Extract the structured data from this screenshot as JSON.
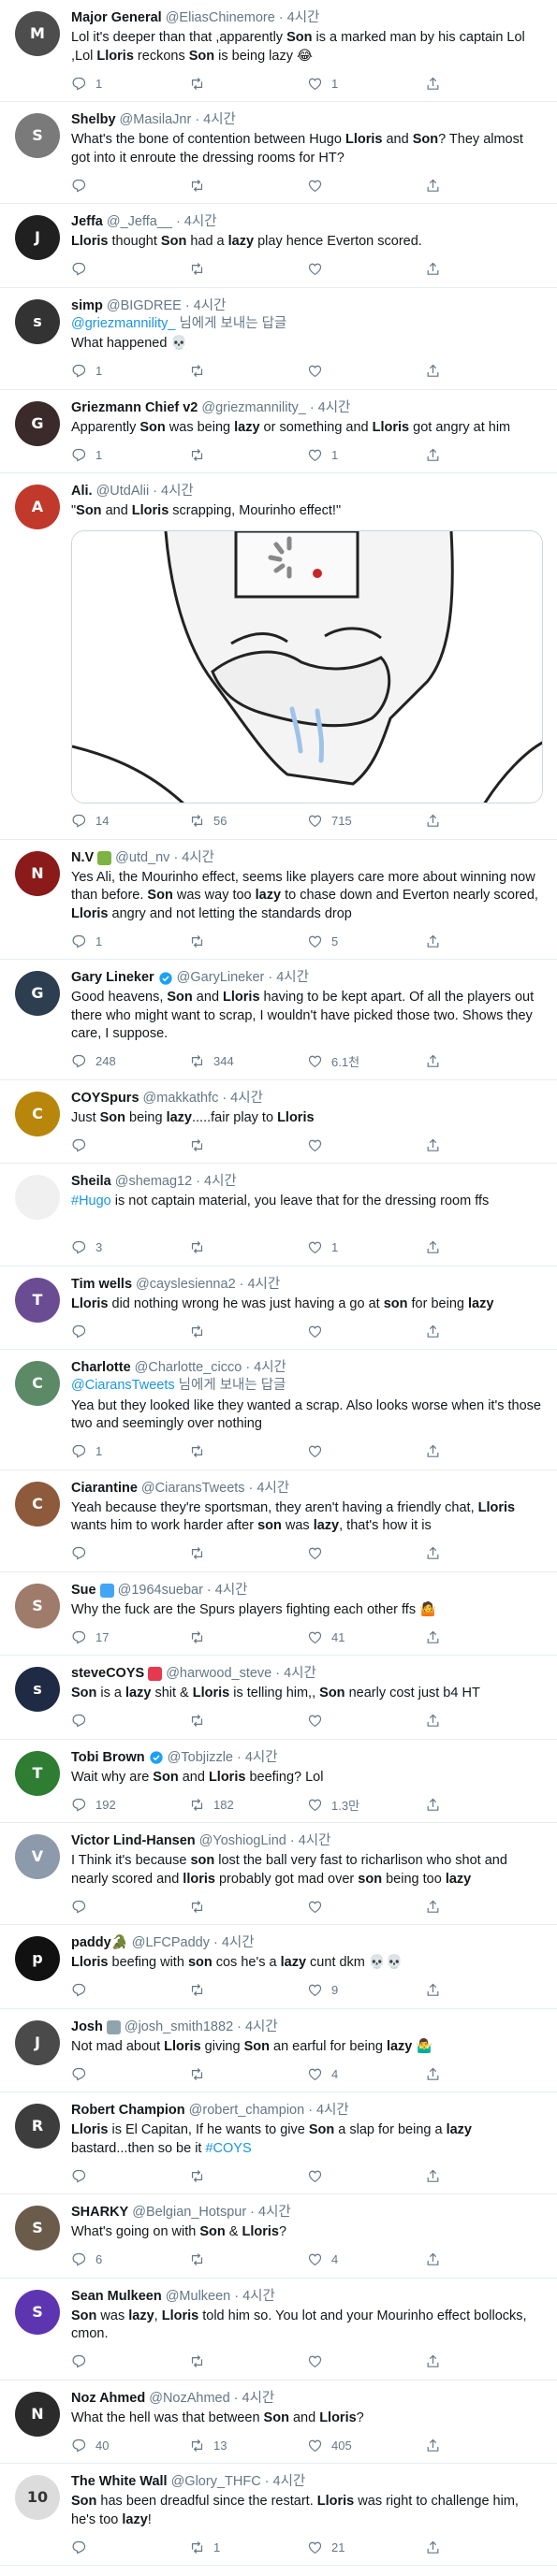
{
  "tweets": [
    {
      "name": "Major General",
      "handle": "@EliasChinemore",
      "time": "4시간",
      "avatar_color": "#4d4d4d",
      "avatar_initial": "M",
      "body": [
        {
          "t": "Lol it's deeper than that ,apparently "
        },
        {
          "t": "Son",
          "b": true
        },
        {
          "t": " is a marked man by his captain Lol ,Lol "
        },
        {
          "t": "Lloris",
          "b": true
        },
        {
          "t": " reckons "
        },
        {
          "t": "Son",
          "b": true
        },
        {
          "t": " is being lazy 😂"
        }
      ],
      "counts": {
        "reply": "1",
        "retweet": "",
        "like": "1"
      }
    },
    {
      "name": "Shelby",
      "handle": "@MasilaJnr",
      "time": "4시간",
      "avatar_color": "#7a7a7a",
      "avatar_initial": "S",
      "body": [
        {
          "t": "What's the bone of contention between Hugo "
        },
        {
          "t": "Lloris",
          "b": true
        },
        {
          "t": " and "
        },
        {
          "t": "Son",
          "b": true
        },
        {
          "t": "? They almost got into it enroute the dressing rooms for HT?"
        }
      ],
      "counts": {
        "reply": "",
        "retweet": "",
        "like": ""
      }
    },
    {
      "name": "Jeffa",
      "handle": "@_Jeffa__",
      "time": "4시간",
      "avatar_color": "#202020",
      "avatar_initial": "J",
      "body": [
        {
          "t": "Lloris",
          "b": true
        },
        {
          "t": " thought "
        },
        {
          "t": "Son",
          "b": true
        },
        {
          "t": " had a "
        },
        {
          "t": "lazy",
          "b": true
        },
        {
          "t": " play hence Everton scored."
        }
      ],
      "counts": {
        "reply": "",
        "retweet": "",
        "like": ""
      }
    },
    {
      "name": "simp",
      "handle": "@BIGDREE",
      "time": "4시간",
      "avatar_color": "#333333",
      "avatar_initial": "s",
      "reply_to": "@griezmannility_",
      "reply_to_suffix": " 님에게 보내는 답글",
      "body": [
        {
          "t": "What happened 💀"
        }
      ],
      "counts": {
        "reply": "1",
        "retweet": "",
        "like": ""
      }
    },
    {
      "name": "Griezmann Chief v2",
      "handle": "@griezmannility_",
      "time": "4시간",
      "avatar_color": "#3a2a2a",
      "avatar_initial": "G",
      "body": [
        {
          "t": "Apparently "
        },
        {
          "t": "Son",
          "b": true
        },
        {
          "t": " was being "
        },
        {
          "t": "lazy",
          "b": true
        },
        {
          "t": " or something and "
        },
        {
          "t": "Lloris",
          "b": true
        },
        {
          "t": " got angry at him"
        }
      ],
      "counts": {
        "reply": "1",
        "retweet": "",
        "like": "1"
      }
    },
    {
      "name": "Ali.",
      "handle": "@UtdAlii",
      "time": "4시간",
      "avatar_color": "#c0392b",
      "avatar_initial": "A",
      "body": [
        {
          "t": "\""
        },
        {
          "t": "Son",
          "b": true
        },
        {
          "t": " and "
        },
        {
          "t": "Lloris",
          "b": true
        },
        {
          "t": " scrapping, Mourinho effect!\""
        }
      ],
      "has_media": true,
      "counts": {
        "reply": "14",
        "retweet": "56",
        "like": "715"
      }
    },
    {
      "name": "N.V",
      "handle": "@utd_nv",
      "time": "4시간",
      "avatar_color": "#8b1a1a",
      "avatar_initial": "N",
      "name_emoji_color": "#7cb342",
      "body": [
        {
          "t": "Yes Ali, the Mourinho effect, seems like players care more about winning now than before. "
        },
        {
          "t": "Son",
          "b": true
        },
        {
          "t": " was way too "
        },
        {
          "t": "lazy",
          "b": true
        },
        {
          "t": " to chase down and Everton nearly scored, "
        },
        {
          "t": "Lloris",
          "b": true
        },
        {
          "t": " angry and not letting the standards drop"
        }
      ],
      "counts": {
        "reply": "1",
        "retweet": "",
        "like": "5"
      }
    },
    {
      "name": "Gary Lineker",
      "handle": "@GaryLineker",
      "time": "4시간",
      "avatar_color": "#2c3e50",
      "avatar_initial": "G",
      "verified": true,
      "body": [
        {
          "t": "Good heavens, "
        },
        {
          "t": "Son",
          "b": true
        },
        {
          "t": " and "
        },
        {
          "t": "Lloris",
          "b": true
        },
        {
          "t": " having to be kept apart. Of all the players out there who might want to scrap, I wouldn't have picked those two. Shows they care, I suppose."
        }
      ],
      "counts": {
        "reply": "248",
        "retweet": "344",
        "like": "6.1천"
      }
    },
    {
      "name": "COYSpurs",
      "handle": "@makkathfc",
      "time": "4시간",
      "avatar_color": "#b8860b",
      "avatar_initial": "C",
      "body": [
        {
          "t": "Just "
        },
        {
          "t": "Son",
          "b": true
        },
        {
          "t": " being "
        },
        {
          "t": "lazy",
          "b": true
        },
        {
          "t": ".....fair play to "
        },
        {
          "t": "Lloris",
          "b": true
        }
      ],
      "counts": {
        "reply": "",
        "retweet": "",
        "like": ""
      }
    },
    {
      "name": "Sheila",
      "handle": "@shemag12",
      "time": "4시간",
      "avatar_color": "#f0f0f0",
      "avatar_initial": "",
      "body": [
        {
          "t": "#Hugo",
          "link": true
        },
        {
          "t": " is not captain material,  you leave that for the dressing room ffs"
        }
      ],
      "extra_gap": true,
      "counts": {
        "reply": "3",
        "retweet": "",
        "like": "1"
      }
    },
    {
      "name": "Tim wells",
      "handle": "@cayslesienna2",
      "time": "4시간",
      "avatar_color": "#6a4c93",
      "avatar_initial": "T",
      "body": [
        {
          "t": "Lloris",
          "b": true
        },
        {
          "t": " did nothing wrong he was just having a go at "
        },
        {
          "t": "son",
          "b": true
        },
        {
          "t": " for being "
        },
        {
          "t": "lazy",
          "b": true
        }
      ],
      "counts": {
        "reply": "",
        "retweet": "",
        "like": ""
      }
    },
    {
      "name": "Charlotte",
      "handle": "@Charlotte_cicco",
      "time": "4시간",
      "avatar_color": "#5d8a66",
      "avatar_initial": "C",
      "reply_to": "@CiaransTweets",
      "reply_to_suffix": " 님에게 보내는 답글",
      "body": [
        {
          "t": "Yea but they looked like they wanted a scrap. Also looks worse when it's those two and seemingly over nothing"
        }
      ],
      "counts": {
        "reply": "1",
        "retweet": "",
        "like": ""
      }
    },
    {
      "name": "Ciarantine",
      "handle": "@CiaransTweets",
      "time": "4시간",
      "avatar_color": "#8e5a3c",
      "avatar_initial": "C",
      "body": [
        {
          "t": "Yeah because they're sportsman, they aren't having a friendly chat, "
        },
        {
          "t": "Lloris",
          "b": true
        },
        {
          "t": " wants him to work harder after "
        },
        {
          "t": "son",
          "b": true
        },
        {
          "t": " was "
        },
        {
          "t": "lazy",
          "b": true
        },
        {
          "t": ", that's how it is"
        }
      ],
      "counts": {
        "reply": "",
        "retweet": "",
        "like": ""
      }
    },
    {
      "name": "Sue",
      "handle": "@1964suebar",
      "time": "4시간",
      "avatar_color": "#9e7b6a",
      "avatar_initial": "S",
      "name_emoji_color": "#42a5f5",
      "body": [
        {
          "t": "Why the fuck are the Spurs players fighting each other ffs 🤷"
        }
      ],
      "counts": {
        "reply": "17",
        "retweet": "",
        "like": "41"
      }
    },
    {
      "name": "steveCOYS",
      "handle": "@harwood_steve",
      "time": "4시간",
      "avatar_color": "#1f2a44",
      "avatar_initial": "s",
      "name_emoji_color": "#e53950",
      "body": [
        {
          "t": "Son",
          "b": true
        },
        {
          "t": " is a "
        },
        {
          "t": "lazy",
          "b": true
        },
        {
          "t": " shit & "
        },
        {
          "t": "Lloris",
          "b": true
        },
        {
          "t": " is telling him,, "
        },
        {
          "t": "Son",
          "b": true
        },
        {
          "t": " nearly cost just b4 HT"
        }
      ],
      "counts": {
        "reply": "",
        "retweet": "",
        "like": ""
      }
    },
    {
      "name": "Tobi Brown",
      "handle": "@Tobjizzle",
      "time": "4시간",
      "avatar_color": "#2e7d32",
      "avatar_initial": "T",
      "verified": true,
      "body": [
        {
          "t": "Wait why are "
        },
        {
          "t": "Son",
          "b": true
        },
        {
          "t": " and "
        },
        {
          "t": "Lloris",
          "b": true
        },
        {
          "t": " beefing? Lol"
        }
      ],
      "counts": {
        "reply": "192",
        "retweet": "182",
        "like": "1.3만"
      }
    },
    {
      "name": "Victor Lind-Hansen",
      "handle": "@YoshiogLind",
      "time": "4시간",
      "avatar_color": "#8c9aab",
      "avatar_initial": "V",
      "body": [
        {
          "t": "I Think it's because "
        },
        {
          "t": "son",
          "b": true
        },
        {
          "t": " lost the ball very fast to richarlison who shot and nearly scored and "
        },
        {
          "t": "lloris",
          "b": true
        },
        {
          "t": " probably got mad over "
        },
        {
          "t": "son",
          "b": true
        },
        {
          "t": " being too "
        },
        {
          "t": "lazy",
          "b": true
        }
      ],
      "counts": {
        "reply": "",
        "retweet": "",
        "like": ""
      }
    },
    {
      "name": "paddy🐊",
      "handle": "@LFCPaddy",
      "time": "4시간",
      "avatar_color": "#111111",
      "avatar_initial": "p",
      "body": [
        {
          "t": "Lloris",
          "b": true
        },
        {
          "t": " beefing with "
        },
        {
          "t": "son",
          "b": true
        },
        {
          "t": " cos he's a "
        },
        {
          "t": "lazy",
          "b": true
        },
        {
          "t": " cunt dkm 💀💀"
        }
      ],
      "counts": {
        "reply": "",
        "retweet": "",
        "like": "9"
      }
    },
    {
      "name": "Josh",
      "handle": "@josh_smith1882",
      "time": "4시간",
      "avatar_color": "#4a4a4a",
      "avatar_initial": "J",
      "name_emoji_color": "#90a4ae",
      "body": [
        {
          "t": "Not mad about "
        },
        {
          "t": "Lloris",
          "b": true
        },
        {
          "t": " giving "
        },
        {
          "t": "Son",
          "b": true
        },
        {
          "t": " an earful for being "
        },
        {
          "t": "lazy",
          "b": true
        },
        {
          "t": " 🤷‍♂️"
        }
      ],
      "counts": {
        "reply": "",
        "retweet": "",
        "like": "4"
      }
    },
    {
      "name": "Robert Champion",
      "handle": "@robert_champion",
      "time": "4시간",
      "avatar_color": "#3d3d3d",
      "avatar_initial": "R",
      "body": [
        {
          "t": "Lloris",
          "b": true
        },
        {
          "t": " is El Capitan, If he wants to give "
        },
        {
          "t": "Son",
          "b": true
        },
        {
          "t": " a slap for being a "
        },
        {
          "t": "lazy",
          "b": true
        },
        {
          "t": " bastard...then so be it "
        },
        {
          "t": "#COYS",
          "link": true
        }
      ],
      "counts": {
        "reply": "",
        "retweet": "",
        "like": ""
      }
    },
    {
      "name": "SHARKY",
      "handle": "@Belgian_Hotspur",
      "time": "4시간",
      "avatar_color": "#6b5b4b",
      "avatar_initial": "S",
      "body": [
        {
          "t": "What's going on with "
        },
        {
          "t": "Son",
          "b": true
        },
        {
          "t": " & "
        },
        {
          "t": "Lloris",
          "b": true
        },
        {
          "t": "?"
        }
      ],
      "counts": {
        "reply": "6",
        "retweet": "",
        "like": "4"
      }
    },
    {
      "name": "Sean Mulkeen",
      "handle": "@Mulkeen",
      "time": "4시간",
      "avatar_color": "#5e35b1",
      "avatar_initial": "S",
      "body": [
        {
          "t": "Son",
          "b": true
        },
        {
          "t": " was "
        },
        {
          "t": "lazy",
          "b": true
        },
        {
          "t": ", "
        },
        {
          "t": "Lloris",
          "b": true
        },
        {
          "t": " told him so. You lot and your Mourinho effect bollocks, cmon."
        }
      ],
      "counts": {
        "reply": "",
        "retweet": "",
        "like": ""
      }
    },
    {
      "name": "Noz Ahmed",
      "handle": "@NozAhmed",
      "time": "4시간",
      "avatar_color": "#2b2b2b",
      "avatar_initial": "N",
      "body": [
        {
          "t": "What the hell was that between "
        },
        {
          "t": "Son",
          "b": true
        },
        {
          "t": " and "
        },
        {
          "t": "Lloris",
          "b": true
        },
        {
          "t": "?"
        }
      ],
      "counts": {
        "reply": "40",
        "retweet": "13",
        "like": "405"
      }
    },
    {
      "name": "The White Wall",
      "handle": "@Glory_THFC",
      "time": "4시간",
      "avatar_color": "#dcdcdc",
      "avatar_initial": "10",
      "body": [
        {
          "t": "Son",
          "b": true
        },
        {
          "t": " has been dreadful since the restart. "
        },
        {
          "t": "Lloris",
          "b": true
        },
        {
          "t": " was right to challenge him, he's too "
        },
        {
          "t": "lazy",
          "b": true
        },
        {
          "t": "!"
        }
      ],
      "counts": {
        "reply": "",
        "retweet": "1",
        "like": "21"
      }
    }
  ]
}
